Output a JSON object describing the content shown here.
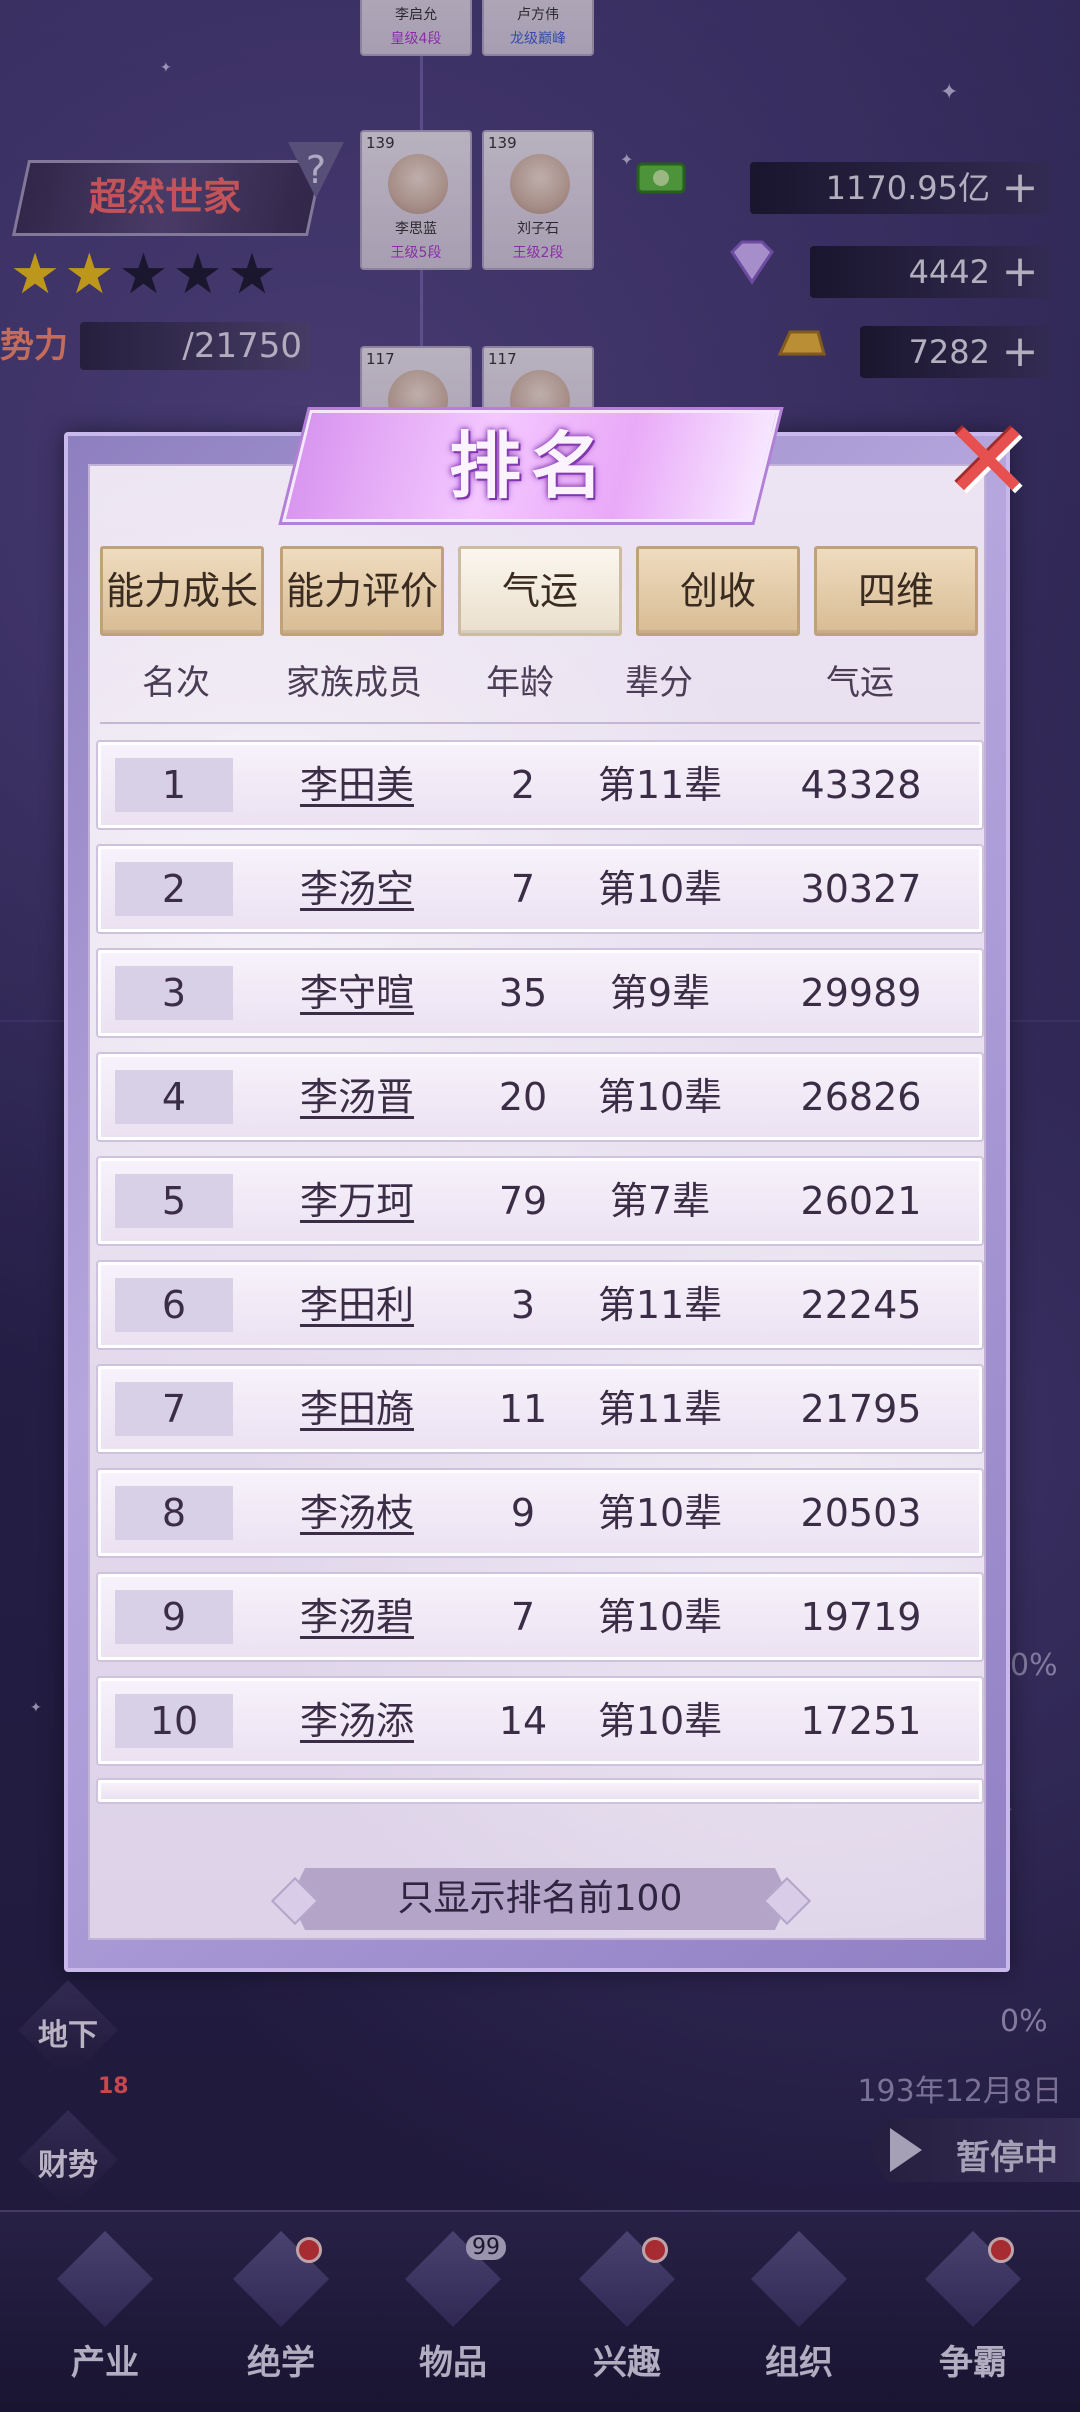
{
  "background": {
    "top_cards": [
      {
        "name": "李启允",
        "rank": "皇级4段"
      },
      {
        "name": "卢方伟",
        "rank": "龙级巅峰"
      }
    ],
    "mid_cards": [
      {
        "level": "139",
        "name": "李思蓝",
        "rank": "王级5段"
      },
      {
        "level": "139",
        "name": "刘子石",
        "rank": "王级2段"
      }
    ],
    "lower_cards": [
      {
        "level": "117"
      },
      {
        "level": "117"
      }
    ],
    "clan_name": "超然世家",
    "help_icon": "?",
    "stars": {
      "filled": 2,
      "total": 5
    },
    "power_label": "势力",
    "power_value": "/21750",
    "resources": [
      {
        "icon": "money-icon",
        "value": "1170.95亿",
        "plus": "+"
      },
      {
        "icon": "diamond-icon",
        "value": "4442",
        "plus": "+"
      },
      {
        "icon": "gold-bar-icon",
        "value": "7282",
        "plus": "+"
      }
    ],
    "side_buttons": [
      {
        "label": "地下"
      },
      {
        "label": "财势",
        "badge": "18"
      }
    ],
    "right_percent_1": "0%",
    "right_percent_2": "0%",
    "date": "193年12月8日",
    "pause_label": "暂停中",
    "bottom_tabs": [
      {
        "label": "产业",
        "icon": "building-icon"
      },
      {
        "label": "绝学",
        "icon": "book-icon",
        "dot": true
      },
      {
        "label": "物品",
        "icon": "toolbox-icon",
        "count": "99"
      },
      {
        "label": "兴趣",
        "icon": "chess-knight-icon",
        "dot": true
      },
      {
        "label": "组织",
        "icon": "org-chart-icon"
      },
      {
        "label": "争霸",
        "icon": "trophy-icon",
        "dot": true
      }
    ]
  },
  "modal": {
    "title": "排名",
    "close_icon": "close-icon",
    "tabs": [
      {
        "label": "能力成长",
        "active": false
      },
      {
        "label": "能力评价",
        "active": false
      },
      {
        "label": "气运",
        "active": true
      },
      {
        "label": "创收",
        "active": false
      },
      {
        "label": "四维",
        "active": false
      }
    ],
    "columns": [
      "名次",
      "家族成员",
      "年龄",
      "辈分",
      "气运"
    ],
    "rows": [
      {
        "rank": "1",
        "name": "李田美",
        "age": "2",
        "generation": "第11辈",
        "luck": "43328"
      },
      {
        "rank": "2",
        "name": "李汤空",
        "age": "7",
        "generation": "第10辈",
        "luck": "30327"
      },
      {
        "rank": "3",
        "name": "李守暄",
        "age": "35",
        "generation": "第9辈",
        "luck": "29989"
      },
      {
        "rank": "4",
        "name": "李汤晋",
        "age": "20",
        "generation": "第10辈",
        "luck": "26826"
      },
      {
        "rank": "5",
        "name": "李万珂",
        "age": "79",
        "generation": "第7辈",
        "luck": "26021"
      },
      {
        "rank": "6",
        "name": "李田利",
        "age": "3",
        "generation": "第11辈",
        "luck": "22245"
      },
      {
        "rank": "7",
        "name": "李田旖",
        "age": "11",
        "generation": "第11辈",
        "luck": "21795"
      },
      {
        "rank": "8",
        "name": "李汤枝",
        "age": "9",
        "generation": "第10辈",
        "luck": "20503"
      },
      {
        "rank": "9",
        "name": "李汤碧",
        "age": "7",
        "generation": "第10辈",
        "luck": "19719"
      },
      {
        "rank": "10",
        "name": "李汤添",
        "age": "14",
        "generation": "第10辈",
        "luck": "17251"
      }
    ],
    "footer": "只显示排名前100"
  }
}
